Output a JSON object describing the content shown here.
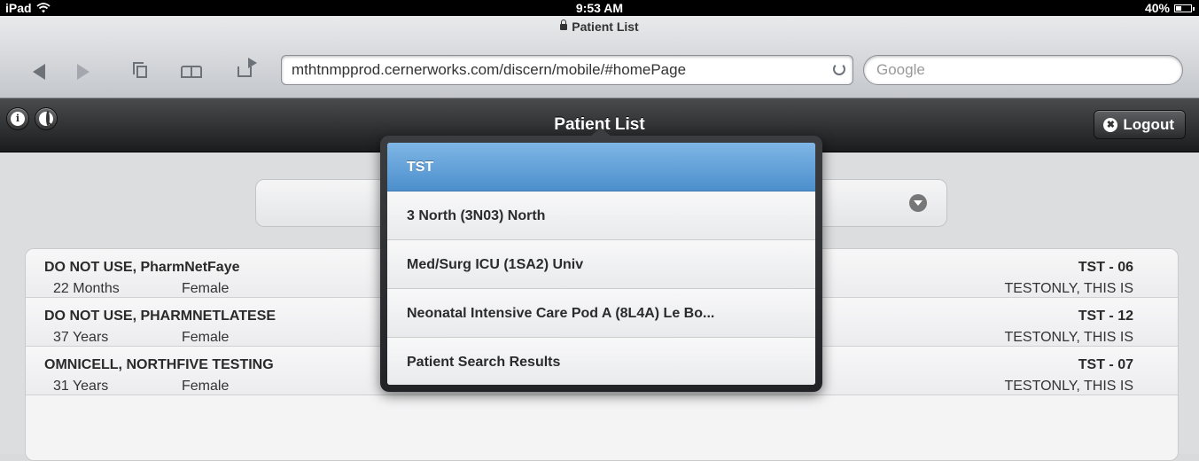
{
  "status_bar": {
    "device": "iPad",
    "time": "9:53 AM",
    "battery": "40%",
    "battery_level": 0.4
  },
  "browser": {
    "title": "Patient List",
    "url": "mthtnmpprod.cernerworks.com/discern/mobile/#homePage",
    "search_placeholder": "Google"
  },
  "header": {
    "title": "Patient List",
    "logout_label": "Logout",
    "info_symbol": "i",
    "close_symbol": "✖"
  },
  "dropdown": {
    "items": [
      {
        "label": "TST",
        "selected": true
      },
      {
        "label": "3 North (3N03) North"
      },
      {
        "label": "Med/Surg ICU (1SA2) Univ"
      },
      {
        "label": "Neonatal Intensive Care Pod A (8L4A) Le Bo..."
      },
      {
        "label": "Patient Search Results"
      }
    ]
  },
  "patients": [
    {
      "name": "DO NOT USE, PharmNetFaye",
      "age": "22 Months",
      "sex": "Female",
      "room": "TST - 06",
      "provider": "TESTONLY, THIS IS"
    },
    {
      "name": "DO NOT USE, PHARMNETLATESE",
      "age": "37 Years",
      "sex": "Female",
      "room": "TST - 12",
      "provider": "TESTONLY, THIS IS"
    },
    {
      "name": "OMNICELL, NORTHFIVE TESTING",
      "age": "31 Years",
      "sex": "Female",
      "room": "TST - 07",
      "provider": "TESTONLY, THIS IS"
    }
  ],
  "colors": {
    "selected": "#5a9bd5",
    "header": "#2a2b2d"
  }
}
